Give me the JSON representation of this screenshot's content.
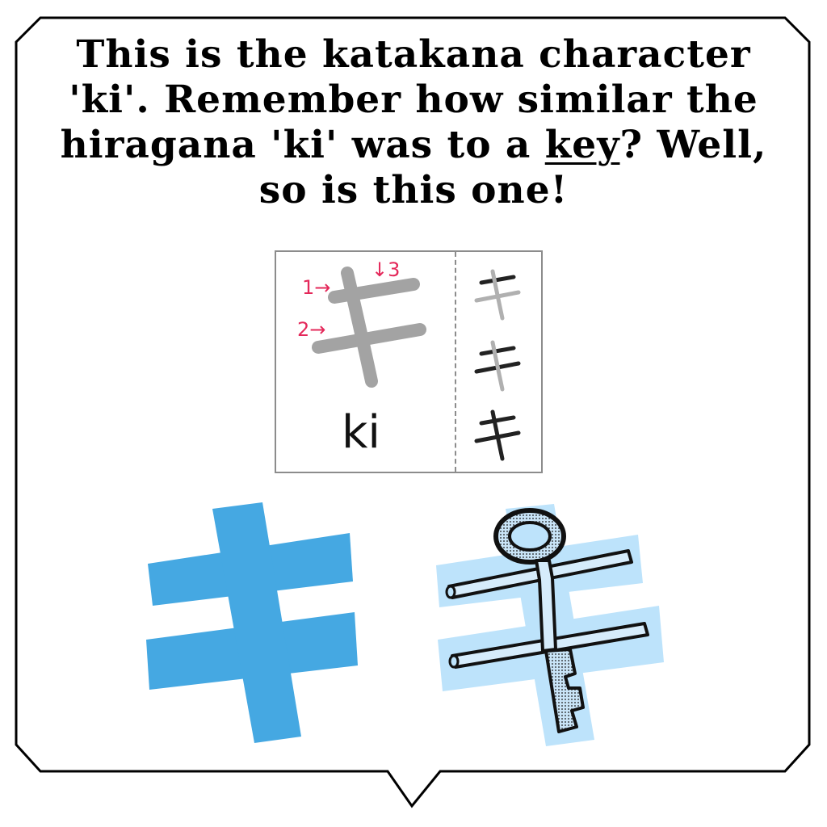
{
  "speech_bubble": {
    "caption": {
      "line1": "This is the katakana character",
      "line2": "'ki'. Remember how similar the",
      "line3_before": "hiragana 'ki' was to a ",
      "line3_key": "key",
      "line3_after": "? Well,",
      "line4": "so is this one!"
    }
  },
  "stroke_card": {
    "stroke_labels": [
      "1→",
      "2→",
      "↓3"
    ],
    "romaji": "ki",
    "steps": [
      "キ",
      "キ",
      "キ"
    ]
  },
  "illustrations": {
    "character_color": "#45a8e2",
    "key_background_color": "#bde3fb",
    "icons": [
      "katakana-ki-large",
      "key-shaped-ki"
    ]
  }
}
